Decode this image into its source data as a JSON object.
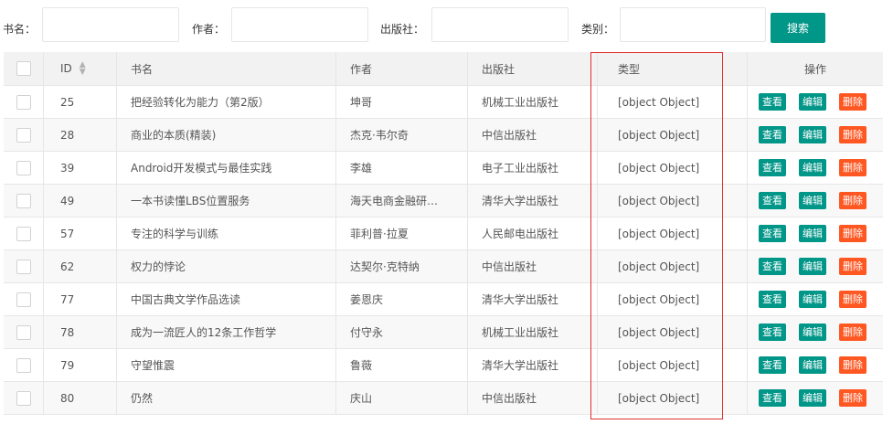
{
  "search": {
    "name_label": "书名：",
    "author_label": "作者：",
    "publisher_label": "出版社：",
    "category_label": "类别：",
    "name_value": "",
    "author_value": "",
    "publisher_value": "",
    "category_value": "",
    "button_label": "搜索"
  },
  "table": {
    "headers": {
      "id": "ID",
      "name": "书名",
      "author": "作者",
      "publisher": "出版社",
      "type": "类型",
      "operation": "操作"
    },
    "operation_labels": {
      "view": "查看",
      "edit": "编辑",
      "delete": "删除"
    },
    "rows": [
      {
        "id": "25",
        "name": "把经验转化为能力（第2版）",
        "author": "坤哥",
        "publisher": "机械工业出版社",
        "type": "[object Object]"
      },
      {
        "id": "28",
        "name": "商业的本质(精装)",
        "author": "杰克·韦尔奇",
        "publisher": "中信出版社",
        "type": "[object Object]"
      },
      {
        "id": "39",
        "name": "Android开发模式与最佳实践",
        "author": "李雄",
        "publisher": "电子工业出版社",
        "type": "[object Object]"
      },
      {
        "id": "49",
        "name": "一本书读懂LBS位置服务",
        "author": "海天电商金融研…",
        "publisher": "清华大学出版社",
        "type": "[object Object]"
      },
      {
        "id": "57",
        "name": "专注的科学与训练",
        "author": "菲利普·拉夏",
        "publisher": "人民邮电出版社",
        "type": "[object Object]"
      },
      {
        "id": "62",
        "name": "权力的悖论",
        "author": "达契尔·克特纳",
        "publisher": "中信出版社",
        "type": "[object Object]"
      },
      {
        "id": "77",
        "name": "中国古典文学作品选读",
        "author": "姜恩庆",
        "publisher": "清华大学出版社",
        "type": "[object Object]"
      },
      {
        "id": "78",
        "name": "成为一流匠人的12条工作哲学",
        "author": "付守永",
        "publisher": "机械工业出版社",
        "type": "[object Object]"
      },
      {
        "id": "79",
        "name": "守望惟震",
        "author": "鲁薇",
        "publisher": "清华大学出版社",
        "type": "[object Object]"
      },
      {
        "id": "80",
        "name": "仍然",
        "author": "庆山",
        "publisher": "中信出版社",
        "type": "[object Object]"
      }
    ]
  },
  "colors": {
    "primary": "#009688",
    "danger": "#ff5722",
    "highlight": "#e0302a"
  }
}
